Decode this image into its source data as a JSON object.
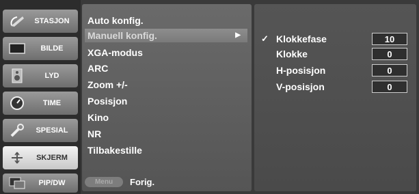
{
  "categories": [
    {
      "label": "STASJON",
      "icon": "satellite-dish-icon"
    },
    {
      "label": "BILDE",
      "icon": "screen-icon"
    },
    {
      "label": "LYD",
      "icon": "speaker-icon"
    },
    {
      "label": "TIME",
      "icon": "clock-icon"
    },
    {
      "label": "SPESIAL",
      "icon": "wrench-icon"
    },
    {
      "label": "SKJERM",
      "icon": "adjust-screen-icon"
    },
    {
      "label": "PIP/DW",
      "icon": "pip-icon"
    }
  ],
  "active_category": "SKJERM",
  "submenu": {
    "items": [
      "Auto konfig.",
      "Manuell konfig.",
      "XGA-modus",
      "ARC",
      "Zoom +/-",
      "Posisjon",
      "Kino",
      "NR",
      "Tilbakestille"
    ],
    "highlighted": "Manuell konfig.",
    "arrow": "▶"
  },
  "footer": {
    "menu_button": "Menu",
    "back_label": "Forig."
  },
  "settings": [
    {
      "label": "Klokkefase",
      "value": "10",
      "selected": true
    },
    {
      "label": "Klokke",
      "value": "0",
      "selected": false
    },
    {
      "label": "H-posisjon",
      "value": "0",
      "selected": false
    },
    {
      "label": "V-posisjon",
      "value": "0",
      "selected": false
    }
  ],
  "check_mark": "✓"
}
